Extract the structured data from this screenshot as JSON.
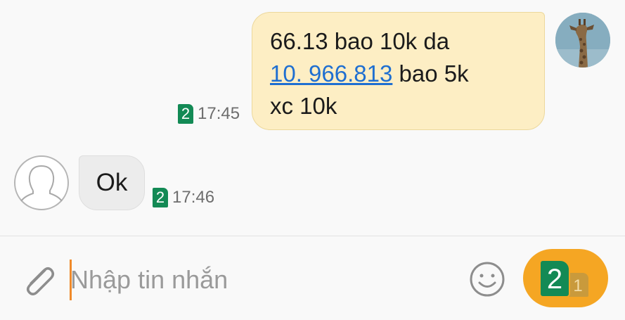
{
  "conversation": {
    "outgoing": {
      "lines": [
        "66.13 bao 10k da",
        "10. 966.813",
        " bao 5k",
        "xc 10k"
      ],
      "sim": "2",
      "time": "17:45"
    },
    "incoming": {
      "text": "Ok",
      "sim": "2",
      "time": "17:46"
    }
  },
  "composer": {
    "placeholder": "Nhập tin nhắn",
    "value": "",
    "send_primary_sim": "2",
    "send_secondary_sim": "1"
  },
  "colors": {
    "outgoing_bubble": "#fdeec4",
    "incoming_bubble": "#ececec",
    "sim_badge": "#138a55",
    "send_button": "#f5a623",
    "link": "#1f6fd1",
    "caret": "#f08a2a"
  },
  "icons": [
    "attach-icon",
    "emoji-icon",
    "sim-icon",
    "send-button"
  ]
}
